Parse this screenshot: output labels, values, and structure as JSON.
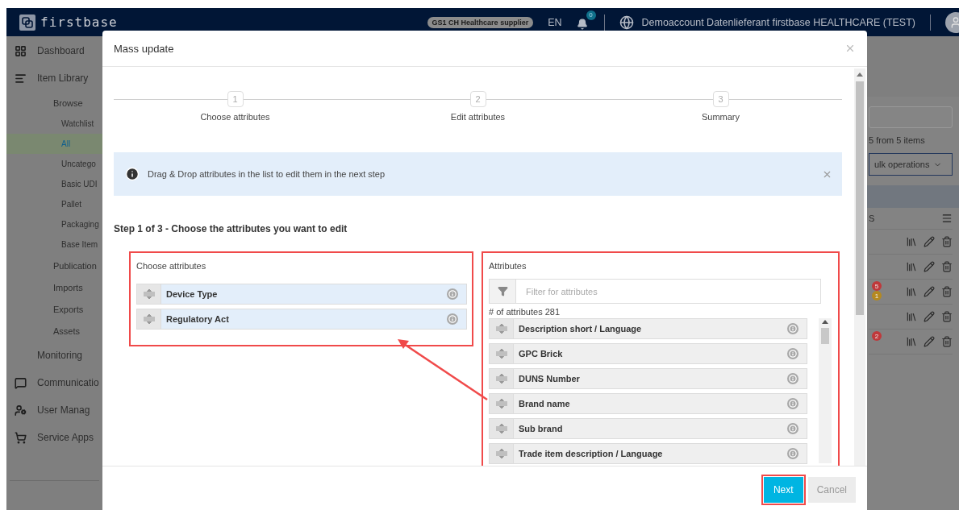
{
  "header": {
    "brand": "firstbase",
    "supplier_badge": "GS1 CH Healthcare supplier",
    "language": "EN",
    "notification_count": "0",
    "account": "Demoaccount Datenlieferant firstbase HEALTHCARE (TEST)"
  },
  "sidebar": {
    "items": [
      {
        "label": "Dashboard",
        "selected": false
      },
      {
        "label": "Item Library",
        "selected": false,
        "children": [
          {
            "label": "Browse",
            "selected": false,
            "children": [
              {
                "label": "Watchlist",
                "selected": false
              },
              {
                "label": "All",
                "selected": true
              },
              {
                "label": "Uncatego",
                "selected": false
              },
              {
                "label": "Basic UDI",
                "selected": false
              },
              {
                "label": "Pallet",
                "selected": false
              },
              {
                "label": "Packaging",
                "selected": false
              },
              {
                "label": "Base Item",
                "selected": false
              }
            ]
          },
          {
            "label": "Publication",
            "selected": false
          },
          {
            "label": "Imports",
            "selected": false
          },
          {
            "label": "Exports",
            "selected": false
          },
          {
            "label": "Assets",
            "selected": false
          }
        ]
      },
      {
        "label": "Monitoring",
        "selected": false
      },
      {
        "label": "Communicatio",
        "selected": false
      },
      {
        "label": "User Manag",
        "selected": false
      },
      {
        "label": "Service Apps",
        "selected": false
      }
    ]
  },
  "content": {
    "result_count": "5 from 5 items",
    "bulk_button": "ulk operations",
    "table": {
      "column_1": "S",
      "rows": [
        {},
        {},
        {
          "badges": [
            {
              "text": "5",
              "color": "#c0393b"
            },
            {
              "text": "1",
              "color": "#b5891f"
            }
          ]
        },
        {},
        {
          "badges": [
            {
              "text": "2",
              "color": "#c0393b"
            }
          ]
        }
      ]
    }
  },
  "modal": {
    "title": "Mass update",
    "steps": [
      {
        "number": "1",
        "label": "Choose attributes"
      },
      {
        "number": "2",
        "label": "Edit attributes"
      },
      {
        "number": "3",
        "label": "Summary"
      }
    ],
    "alert": {
      "text": "Drag & Drop attributes in the list to edit them in the next step"
    },
    "step_heading": "Step 1 of 3 - Choose the attributes you want to edit",
    "chosen_panel": {
      "title": "Choose attributes",
      "items": [
        "Device Type",
        "Regulatory Act"
      ]
    },
    "attributes_panel": {
      "title": "Attributes",
      "filter_placeholder": "Filter for attributes",
      "count": "# of attributes 281",
      "items": [
        "Description short / Language",
        "GPC Brick",
        "DUNS Number",
        "Brand name",
        "Sub brand",
        "Trade item description / Language"
      ]
    },
    "buttons": {
      "next": "Next",
      "cancel": "Cancel"
    }
  }
}
